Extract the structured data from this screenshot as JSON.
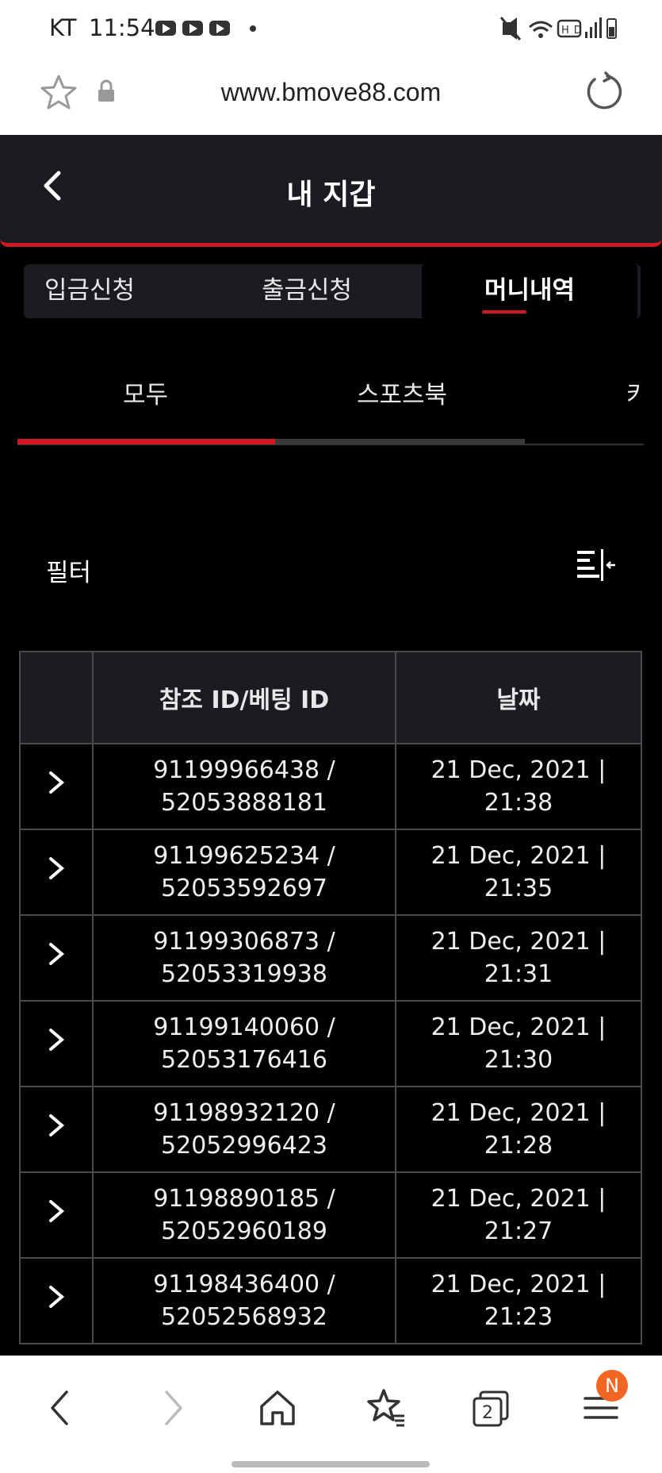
{
  "status": {
    "carrier": "KT",
    "time": "11:54"
  },
  "browser": {
    "url": "www.bmove88.com"
  },
  "header": {
    "title": "내 지갑"
  },
  "tabs": [
    {
      "label": "입금신청"
    },
    {
      "label": "출금신청"
    },
    {
      "label": "머니내역",
      "active": true
    }
  ],
  "subtabs": [
    {
      "label": "모두",
      "active": true
    },
    {
      "label": "스포츠북"
    },
    {
      "label": "카"
    }
  ],
  "filter": {
    "label": "필터"
  },
  "table": {
    "headers": [
      "",
      "참조 ID/베팅 ID",
      "날짜"
    ],
    "rows": [
      {
        "ref_line1": "91199966438 /",
        "ref_line2": "52053888181",
        "date_line1": "21 Dec, 2021 |",
        "date_line2": "21:38"
      },
      {
        "ref_line1": "91199625234 /",
        "ref_line2": "52053592697",
        "date_line1": "21 Dec, 2021 |",
        "date_line2": "21:35"
      },
      {
        "ref_line1": "91199306873 /",
        "ref_line2": "52053319938",
        "date_line1": "21 Dec, 2021 |",
        "date_line2": "21:31"
      },
      {
        "ref_line1": "91199140060 /",
        "ref_line2": "52053176416",
        "date_line1": "21 Dec, 2021 |",
        "date_line2": "21:30"
      },
      {
        "ref_line1": "91198932120 /",
        "ref_line2": "52052996423",
        "date_line1": "21 Dec, 2021 |",
        "date_line2": "21:28"
      },
      {
        "ref_line1": "91198890185 /",
        "ref_line2": "52052960189",
        "date_line1": "21 Dec, 2021 |",
        "date_line2": "21:27"
      },
      {
        "ref_line1": "91198436400 /",
        "ref_line2": "52052568932",
        "date_line1": "21 Dec, 2021 |",
        "date_line2": "21:23"
      }
    ]
  },
  "bottom_nav": {
    "tab_count": "2",
    "menu_badge": "N"
  },
  "colors": {
    "accent": "#d01a22",
    "panel": "#1b1c21",
    "badge": "#f26522"
  }
}
